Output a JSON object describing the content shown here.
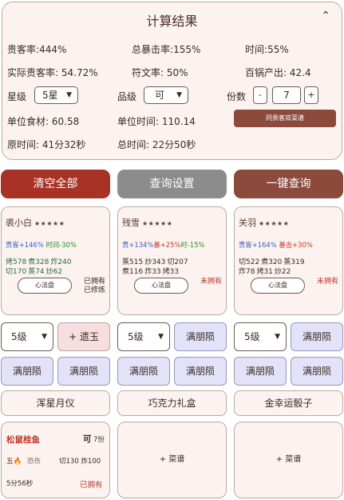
{
  "result": {
    "title": "计算结果",
    "stats": [
      {
        "label": "贵客率",
        "value": "444%"
      },
      {
        "label": "总暴击率",
        "value": "155%"
      },
      {
        "label": "时间",
        "value": "55%"
      },
      {
        "label": "实际贵客率",
        "value": "54.72%"
      },
      {
        "label": "符文率",
        "value": "50%"
      },
      {
        "label": "百锅产出",
        "value": "42.4"
      }
    ],
    "star_label": "星级",
    "star_value": "5星",
    "grade_label": "品级",
    "grade_value": "可",
    "portions_label": "份数",
    "portions_value": "7",
    "minus": "-",
    "plus": "+",
    "unit_food_label": "单位食材",
    "unit_food_value": "60.58",
    "unit_time_label": "单位时间",
    "unit_time_value": "110.14",
    "double_button": "同贵客双菜谱",
    "orig_time_label": "原时间",
    "orig_time_value": "41分32秒",
    "total_time_label": "总时间",
    "total_time_value": "22分50秒"
  },
  "actions": {
    "clear": "清空全部",
    "settings": "查询设置",
    "query": "一键查询"
  },
  "chefs": [
    {
      "name": "裘小白",
      "stars": "★★★★★",
      "buff_a": "贵客+146%",
      "buff_b": "时间-30%",
      "skills_1": [
        "烤578",
        "煮328",
        "炸240"
      ],
      "skills_2": [
        "切170",
        "蒸74",
        "炒62"
      ],
      "xinfa": "心法盘",
      "owned_1": "已拥有",
      "owned_2": "已修炼"
    },
    {
      "name": "残雪",
      "stars": "★★★★★",
      "buff_a": "贵+134%",
      "buff_b": "暴+25%",
      "buff_c": "时-15%",
      "skills_1": [
        "蒸515",
        "炒343",
        "切207"
      ],
      "skills_2": [
        "煮116",
        "炸33",
        "烤33"
      ],
      "xinfa": "心法盘",
      "owned_1": "未拥有"
    },
    {
      "name": "关羽",
      "stars": "★★★★★",
      "buff_a": "贵客+164%",
      "buff_b": "暴击+30%",
      "skills_1": [
        "切522",
        "煮320",
        "蒸319"
      ],
      "skills_2": [
        "炸78",
        "烤31",
        "炒22"
      ],
      "xinfa": "心法盘",
      "owned_1": "未拥有"
    }
  ],
  "equip": {
    "level": "5级",
    "yuanyu": "+ 遗玉",
    "mandou": "满朋陨"
  },
  "items": [
    "浑星月仪",
    "巧克力礼盒",
    "金幸运骰子"
  ],
  "recipe": {
    "name": "松鼠桂鱼",
    "grade": "可",
    "portions": "7份",
    "five": "五🔥",
    "skill_tag": "恐伤",
    "req": "切130 炸100",
    "time": "5分56秒",
    "owned": "已拥有",
    "add": "+ 菜谱"
  },
  "colors": {
    "clear": "#a93226",
    "settings": "#8c8c8c",
    "query": "#8b4a3b"
  }
}
